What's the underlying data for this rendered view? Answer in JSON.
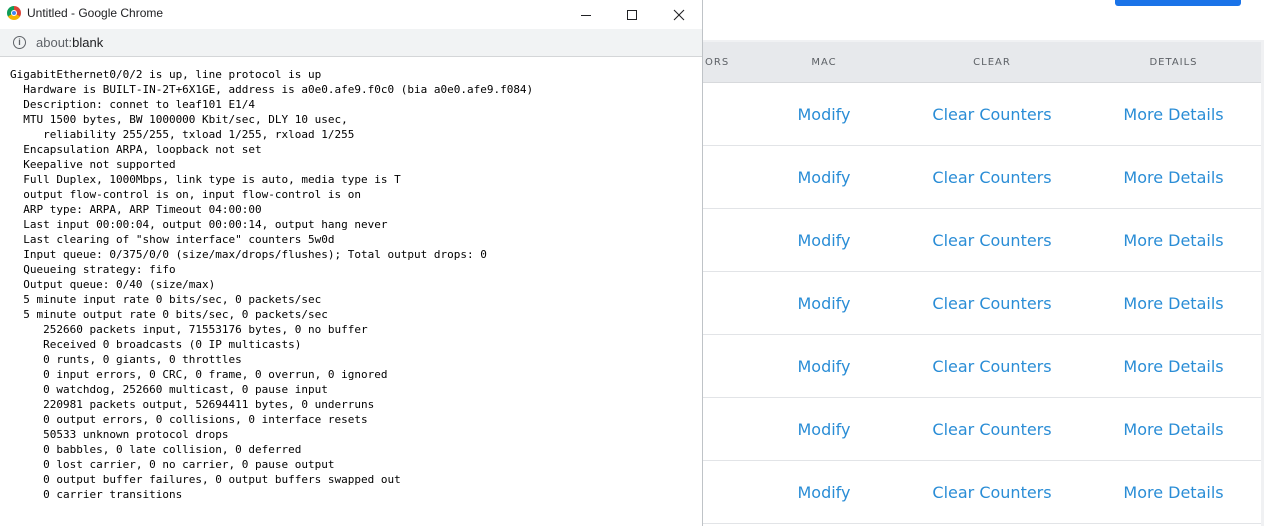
{
  "background_app": {
    "table": {
      "headers": {
        "partial_col": "ORS",
        "mac": "MAC",
        "clear": "CLEAR",
        "details": "DETAILS"
      },
      "rows": [
        {
          "modify": "Modify",
          "clear": "Clear Counters",
          "details": "More Details"
        },
        {
          "modify": "Modify",
          "clear": "Clear Counters",
          "details": "More Details"
        },
        {
          "modify": "Modify",
          "clear": "Clear Counters",
          "details": "More Details"
        },
        {
          "modify": "Modify",
          "clear": "Clear Counters",
          "details": "More Details"
        },
        {
          "modify": "Modify",
          "clear": "Clear Counters",
          "details": "More Details"
        },
        {
          "modify": "Modify",
          "clear": "Clear Counters",
          "details": "More Details"
        },
        {
          "modify": "Modify",
          "clear": "Clear Counters",
          "details": "More Details"
        }
      ]
    },
    "colors": {
      "link": "#2a8dd6",
      "primary": "#1a73e8",
      "header_bg": "#e7e9ec"
    }
  },
  "popup": {
    "window_title": "Untitled - Google Chrome",
    "address": {
      "scheme": "about:",
      "path": "blank"
    },
    "icons": {
      "logo": "chrome-logo-icon",
      "info": "info-icon",
      "minimize": "minimize-icon",
      "maximize": "maximize-icon",
      "close": "close-icon"
    },
    "output_lines": [
      "GigabitEthernet0/0/2 is up, line protocol is up",
      "  Hardware is BUILT-IN-2T+6X1GE, address is a0e0.afe9.f0c0 (bia a0e0.afe9.f084)",
      "  Description: connet to leaf101 E1/4",
      "  MTU 1500 bytes, BW 1000000 Kbit/sec, DLY 10 usec,",
      "     reliability 255/255, txload 1/255, rxload 1/255",
      "  Encapsulation ARPA, loopback not set",
      "  Keepalive not supported",
      "  Full Duplex, 1000Mbps, link type is auto, media type is T",
      "  output flow-control is on, input flow-control is on",
      "  ARP type: ARPA, ARP Timeout 04:00:00",
      "  Last input 00:00:04, output 00:00:14, output hang never",
      "  Last clearing of \"show interface\" counters 5w0d",
      "  Input queue: 0/375/0/0 (size/max/drops/flushes); Total output drops: 0",
      "  Queueing strategy: fifo",
      "  Output queue: 0/40 (size/max)",
      "  5 minute input rate 0 bits/sec, 0 packets/sec",
      "  5 minute output rate 0 bits/sec, 0 packets/sec",
      "     252660 packets input, 71553176 bytes, 0 no buffer",
      "     Received 0 broadcasts (0 IP multicasts)",
      "     0 runts, 0 giants, 0 throttles",
      "     0 input errors, 0 CRC, 0 frame, 0 overrun, 0 ignored",
      "     0 watchdog, 252660 multicast, 0 pause input",
      "     220981 packets output, 52694411 bytes, 0 underruns",
      "     0 output errors, 0 collisions, 0 interface resets",
      "     50533 unknown protocol drops",
      "     0 babbles, 0 late collision, 0 deferred",
      "     0 lost carrier, 0 no carrier, 0 pause output",
      "     0 output buffer failures, 0 output buffers swapped out",
      "     0 carrier transitions"
    ]
  }
}
